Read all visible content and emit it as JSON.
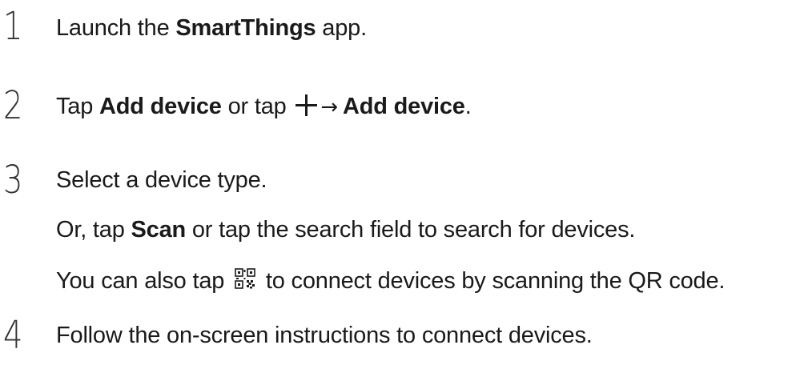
{
  "steps": [
    {
      "number": "1",
      "before": "Launch the ",
      "bold": "SmartThings",
      "after": " app."
    },
    {
      "number": "2",
      "before": "Tap ",
      "bold1": "Add device",
      "middle": " or tap ",
      "arrow": "→",
      "bold2": "Add device",
      "after": ".",
      "icon": "plus-icon"
    },
    {
      "number": "3",
      "line1": "Select a device type.",
      "line2_before": "Or, tap ",
      "line2_bold": "Scan",
      "line2_after": " or tap the search field to search for devices.",
      "line3_before": "You can also tap ",
      "line3_after": " to connect devices by scanning the QR code.",
      "icon": "qr-code-icon"
    },
    {
      "number": "4",
      "line1": "Follow the on-screen instructions to connect devices."
    }
  ]
}
